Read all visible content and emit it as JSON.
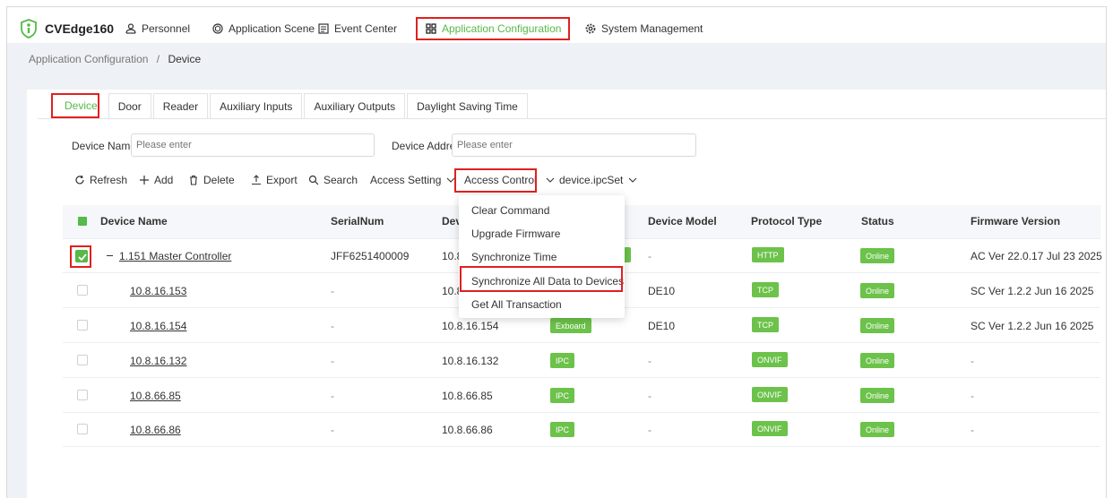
{
  "app": {
    "name": "CVEdge160",
    "logo_icon": "person-shield-icon"
  },
  "nav": {
    "items": [
      {
        "label": "Personnel",
        "icon": "users-icon"
      },
      {
        "label": "Application Scene",
        "icon": "gear-cube-icon"
      },
      {
        "label": "Event Center",
        "icon": "event-icon"
      },
      {
        "label": "Application Configuration",
        "icon": "grid-icon",
        "active": true
      },
      {
        "label": "System Management",
        "icon": "settings-icon"
      }
    ]
  },
  "breadcrumb": {
    "parent": "Application Configuration",
    "separator": "/",
    "current": "Device"
  },
  "tabs": [
    "Device",
    "Door",
    "Reader",
    "Auxiliary Inputs",
    "Auxiliary Outputs",
    "Daylight Saving Time"
  ],
  "filters": {
    "device_name_label": "Device Name",
    "device_name_placeholder": "Please enter",
    "device_address_label": "Device Addre",
    "device_address_placeholder": "Please enter"
  },
  "toolbar": {
    "refresh": "Refresh",
    "add": "Add",
    "delete": "Delete",
    "export": "Export",
    "search": "Search",
    "access_setting": "Access Setting",
    "access_control": "Access Control",
    "ipc_set": "device.ipcSet"
  },
  "table": {
    "headers": {
      "name": "Device Name",
      "serial": "SerialNum",
      "address": "Dev",
      "model": "Device Model",
      "protocol": "Protocol Type",
      "status": "Status",
      "firmware": "Firmware Version"
    },
    "rows": [
      {
        "name": "1.151 Master Controller",
        "serial": "JFF6251400009",
        "address": "10.8",
        "type": "",
        "model": "-",
        "protocol": "HTTP",
        "status": "Online",
        "firmware": "AC Ver 22.0.17 Jul 23 2025",
        "checked": true
      },
      {
        "name": "10.8.16.153",
        "serial": "-",
        "address": "10.8",
        "type": "",
        "model": "DE10",
        "protocol": "TCP",
        "status": "Online",
        "firmware": "SC Ver 1.2.2 Jun 16 2025"
      },
      {
        "name": "10.8.16.154",
        "serial": "-",
        "address": "10.8.16.154",
        "type": "Exboard",
        "model": "DE10",
        "protocol": "TCP",
        "status": "Online",
        "firmware": "SC Ver 1.2.2 Jun 16 2025"
      },
      {
        "name": "10.8.16.132",
        "serial": "-",
        "address": "10.8.16.132",
        "type": "IPC",
        "model": "-",
        "protocol": "ONVIF",
        "status": "Online",
        "firmware": "-"
      },
      {
        "name": "10.8.66.85",
        "serial": "-",
        "address": "10.8.66.85",
        "type": "IPC",
        "model": "-",
        "protocol": "ONVIF",
        "status": "Online",
        "firmware": "-"
      },
      {
        "name": "10.8.66.86",
        "serial": "-",
        "address": "10.8.66.86",
        "type": "IPC",
        "model": "-",
        "protocol": "ONVIF",
        "status": "Online",
        "firmware": "-"
      }
    ]
  },
  "access_control_menu": [
    "Clear Command",
    "Upgrade Firmware",
    "Synchronize Time",
    "Synchronize All Data to Devices",
    "Get All Transaction"
  ],
  "colors": {
    "accent": "#56b948",
    "badge": "#6cc24a",
    "highlight": "#e02020"
  }
}
